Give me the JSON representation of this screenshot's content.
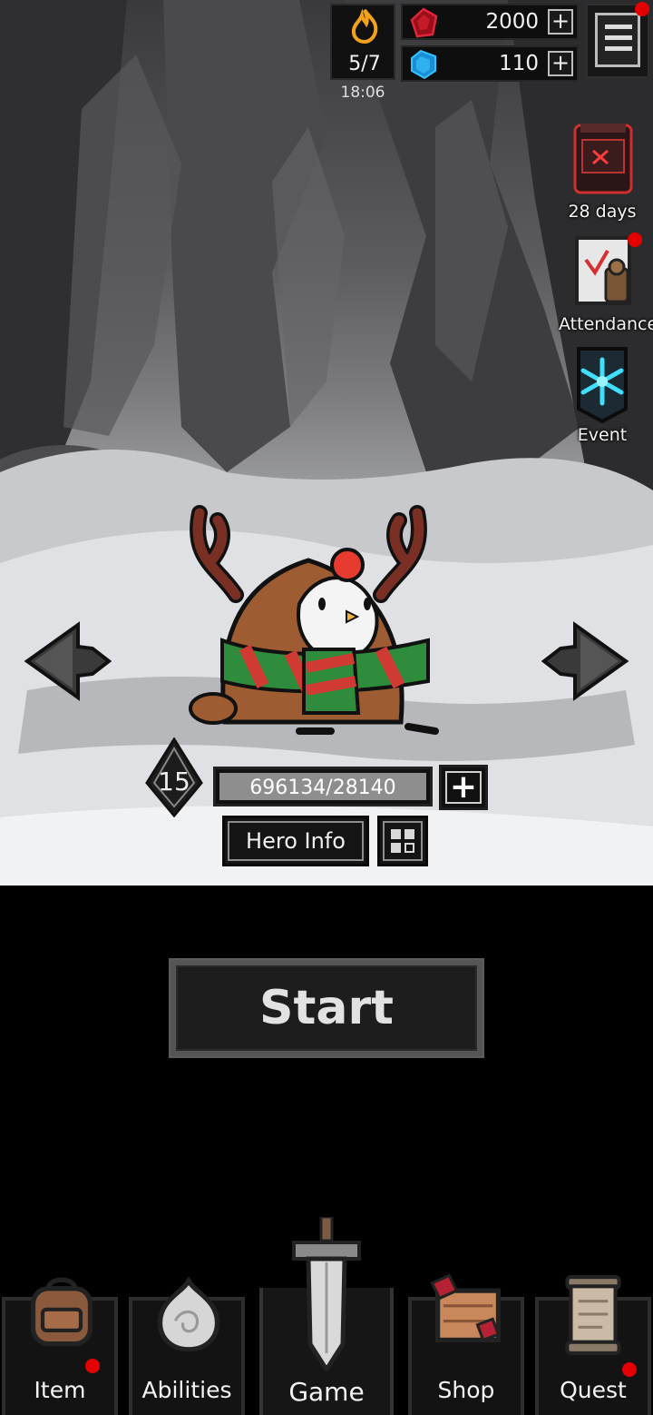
{
  "hud": {
    "energy": "5/7",
    "energy_timer": "18:06",
    "red_gems": "2000",
    "blue_gems": "110",
    "plus": "+"
  },
  "side_buttons": {
    "pass_label": "28 days",
    "attendance_label": "Attendance",
    "event_label": "Event"
  },
  "hero": {
    "level": "15",
    "xp_text": "696134/28140",
    "xp_plus": "+",
    "hero_info_label": "Hero Info"
  },
  "start_label": "Start",
  "nav": {
    "item": "Item",
    "abilities": "Abilities",
    "game": "Game",
    "shop": "Shop",
    "quest": "Quest"
  },
  "colors": {
    "notification": "#e40000",
    "background": "#000000",
    "panel": "#1d1d1d"
  },
  "icons": [
    "flame-icon",
    "red-gem-icon",
    "blue-gem-icon",
    "hamburger-menu-icon",
    "battle-pass-icon",
    "attendance-icon",
    "snowflake-event-icon",
    "arrow-left-icon",
    "arrow-right-icon",
    "grid-icon",
    "backpack-icon",
    "orb-icon",
    "sword-icon",
    "shop-crate-icon",
    "scroll-icon"
  ]
}
